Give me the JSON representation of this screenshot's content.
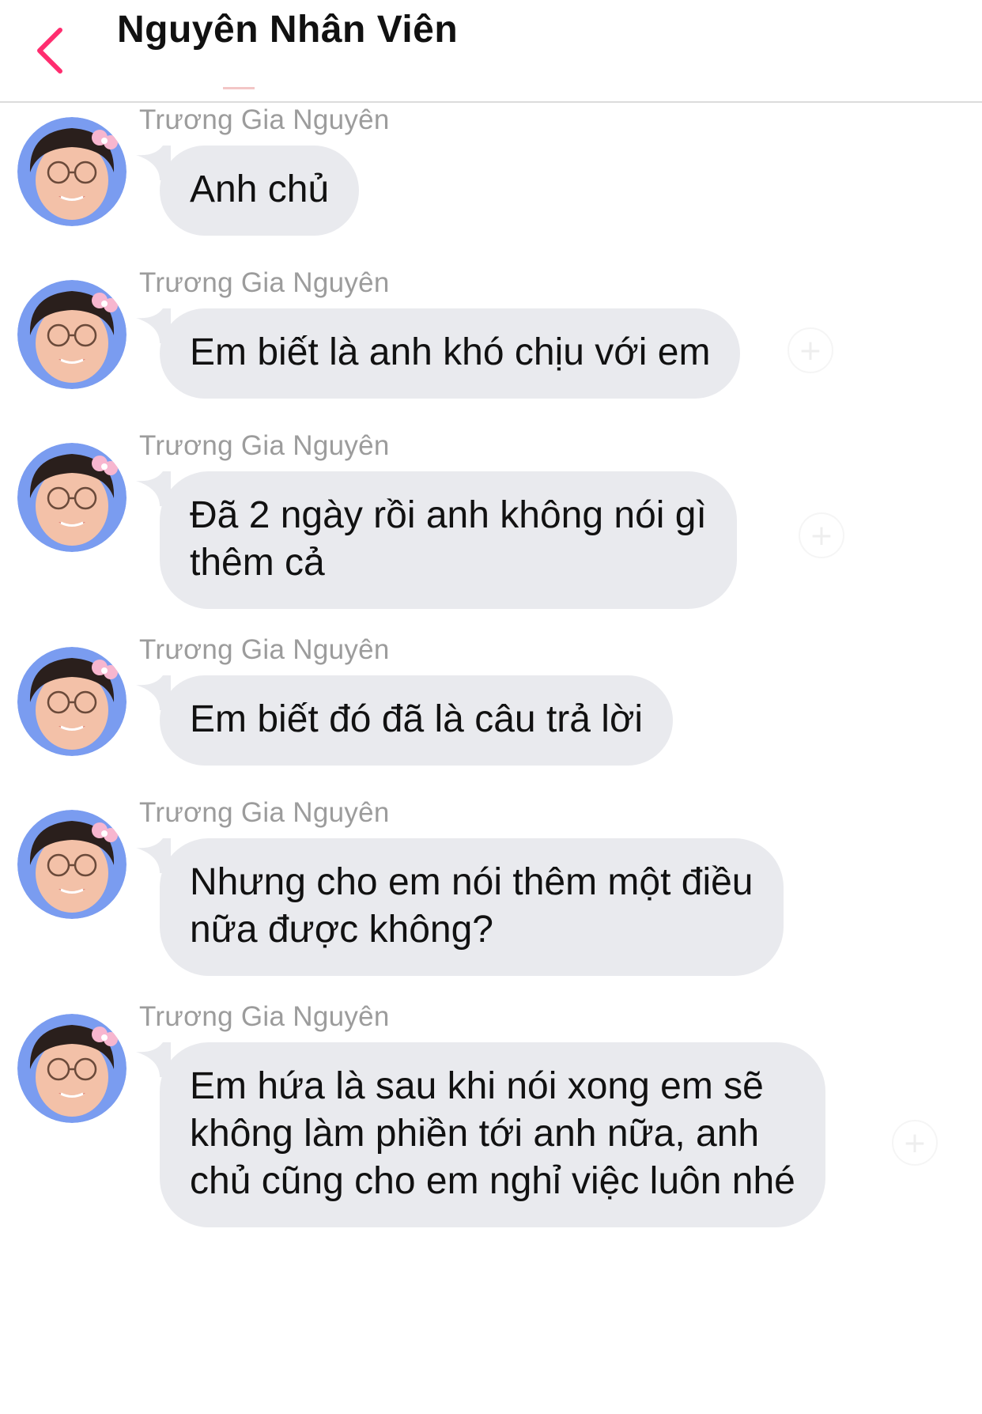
{
  "header": {
    "title": "Nguyên Nhân Viên",
    "back_icon": "chevron-left-icon",
    "accent_color": "#ff2d6f"
  },
  "messages": [
    {
      "sender": "Trương Gia Nguyên",
      "text": "Anh chủ"
    },
    {
      "sender": "Trương Gia Nguyên",
      "text": "Em biết là anh khó chịu với em"
    },
    {
      "sender": "Trương Gia Nguyên",
      "text": "Đã 2 ngày rồi anh không nói gì\nthêm cả"
    },
    {
      "sender": "Trương Gia Nguyên",
      "text": "Em biết đó đã là câu trả lời"
    },
    {
      "sender": "Trương Gia Nguyên",
      "text": "Nhưng cho em nói thêm một điều\nnữa được không?"
    },
    {
      "sender": "Trương Gia Nguyên",
      "text": "Em hứa là sau khi nói xong em sẽ\nkhông làm phiền tới anh nữa, anh\nchủ cũng cho em nghỉ việc luôn nhé"
    }
  ],
  "colors": {
    "bubble": "#e9eaee",
    "sender_text": "#9c9c9c",
    "avatar_ring": "#7a9cf0"
  }
}
